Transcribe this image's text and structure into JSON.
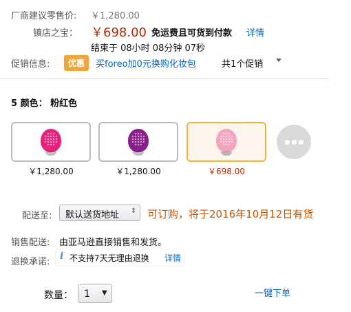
{
  "list_price": {
    "label": "厂商建议零售价:",
    "value": "￥1,280.00"
  },
  "deal": {
    "label": "镇店之宝：",
    "price": "￥698.00",
    "shipping": "免运费且可货到付款",
    "details_link": "详情",
    "countdown": "结束于 08小时 08分钟 07秒"
  },
  "promotion": {
    "label": "促销信息:",
    "badge": "优惠",
    "offer_link": "买foreo加0元换购化妆包",
    "count_text": "共1个促销",
    "toggle_icon": "caret-down-icon"
  },
  "color": {
    "index": "5",
    "label": "颜色：",
    "selected_value": "粉红色",
    "swatches": [
      {
        "name": "magenta",
        "price": "￥1,280.00",
        "color": "#e8217c",
        "selected": false
      },
      {
        "name": "purple",
        "price": "￥1,280.00",
        "color": "#8a1f8c",
        "selected": false
      },
      {
        "name": "pink",
        "price": "￥698.00",
        "color": "#f4a4bf",
        "selected": true
      }
    ],
    "more_icon": "ellipsis-icon"
  },
  "shipping": {
    "label": "配送至:",
    "address_select": "默认送货地址",
    "availability": "可订购，将于2016年10月12日有货"
  },
  "sales": {
    "label": "销售配送:",
    "value": "由亚马逊直接销售和发货。"
  },
  "returns": {
    "label": "退换承诺:",
    "icon": "info-icon",
    "value": "不支持7天无理由退换",
    "details_link": "详情"
  },
  "quantity": {
    "label": "数量：",
    "value": "1",
    "one_click_link": "一键下单"
  }
}
